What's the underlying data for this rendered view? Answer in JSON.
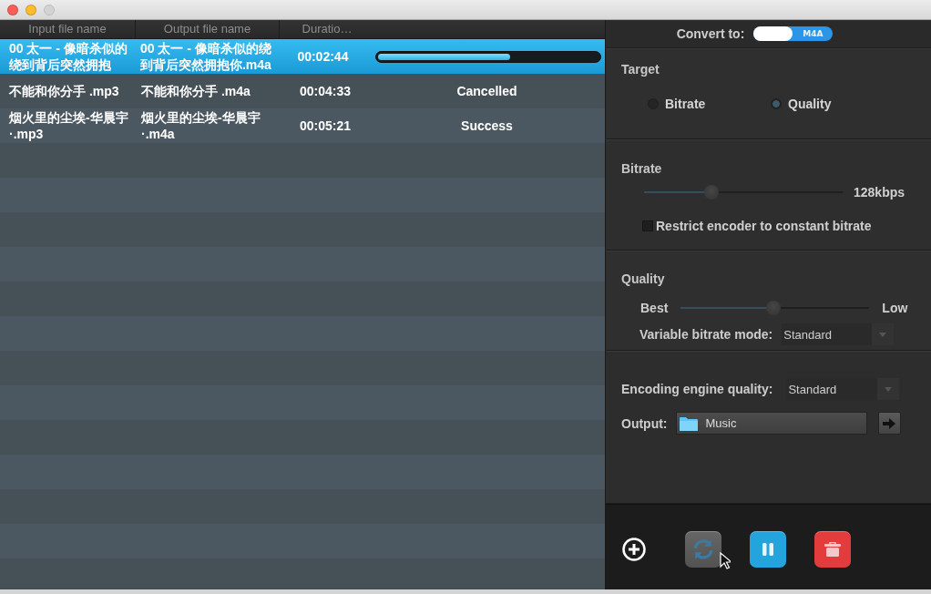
{
  "window": {
    "buttons": [
      {
        "kind": "close",
        "disabled": false
      },
      {
        "kind": "minimize",
        "disabled": false
      },
      {
        "kind": "zoom",
        "disabled": true
      }
    ]
  },
  "table": {
    "columns": [
      "Input file name",
      "Output file name",
      "Duratio…"
    ],
    "rows": [
      {
        "input": "00 太一 - 像暗杀似的绕到背后突然拥抱",
        "output": "00 太一 - 像暗杀似的绕到背后突然拥抱你.m4a",
        "duration": "00:02:44",
        "selected": true,
        "kind": "progress",
        "level": 0.6
      },
      {
        "input": "不能和你分手 .mp3",
        "output": "不能和你分手 .m4a",
        "duration": "00:04:33",
        "selected": false,
        "kind": "status",
        "status": "Cancelled"
      },
      {
        "input": "烟火里的尘埃-华晨宇 ·.mp3",
        "output": "烟火里的尘埃-华晨宇 ·.m4a",
        "duration": "00:05:21",
        "selected": false,
        "kind": "status",
        "status": "Success"
      }
    ]
  },
  "convert_to": {
    "label": "Convert to:",
    "format": "M4A"
  },
  "target": {
    "title": "Target",
    "options": [
      {
        "label": "Bitrate",
        "selected": false
      },
      {
        "label": "Quality",
        "selected": true
      }
    ]
  },
  "bitrate": {
    "title": "Bitrate",
    "slider": {
      "level": 0.34
    },
    "reading": "128kbps",
    "restrict": {
      "label": "Restrict encoder to constant bitrate",
      "checked": false
    }
  },
  "quality": {
    "title": "Quality",
    "min_label": "Best",
    "max_label": "Low",
    "slider": {
      "level": 0.49
    },
    "vbr_mode": {
      "label": "Variable bitrate mode:",
      "value": "Standard"
    }
  },
  "encoding": {
    "label": "Encoding engine quality:",
    "value": "Standard"
  },
  "output": {
    "label": "Output:",
    "value": "Music"
  },
  "toolbar": {
    "buttons": [
      {
        "kind": "add",
        "disabled": false
      },
      {
        "kind": "convert",
        "disabled": true
      },
      {
        "kind": "pause",
        "disabled": false
      },
      {
        "kind": "stop",
        "disabled": false
      }
    ]
  }
}
